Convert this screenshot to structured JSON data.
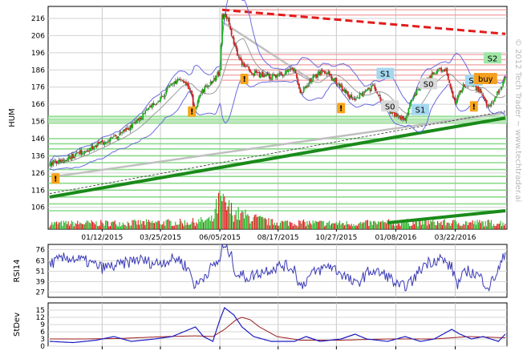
{
  "chart_data": {
    "type": "candlestick",
    "symbol": "HUM",
    "watermark": "© 2012 Tech Trader ~ www.techtrader.ai",
    "main": {
      "ylabel": "HUM",
      "y_ticks": [
        216,
        206,
        196,
        186,
        176,
        166,
        156,
        146,
        136,
        126,
        116,
        106
      ],
      "ylim": [
        97,
        223
      ],
      "x_tick_labels": [
        "01/12/2015",
        "03/25/2015",
        "06/05/2015",
        "08/17/2015",
        "10/27/2015",
        "01/08/2016",
        "03/22/2016"
      ],
      "x_tick_index": [
        45,
        95,
        146,
        196,
        246,
        297,
        348
      ],
      "n_bars": 392,
      "price_path": [
        [
          0,
          131
        ],
        [
          20,
          136
        ],
        [
          40,
          142
        ],
        [
          60,
          148
        ],
        [
          80,
          160
        ],
        [
          95,
          170
        ],
        [
          110,
          181
        ],
        [
          120,
          176
        ],
        [
          124,
          163
        ],
        [
          130,
          173
        ],
        [
          140,
          180
        ],
        [
          146,
          185
        ],
        [
          148,
          218
        ],
        [
          153,
          216
        ],
        [
          158,
          200
        ],
        [
          165,
          190
        ],
        [
          175,
          184
        ],
        [
          190,
          182
        ],
        [
          200,
          184
        ],
        [
          210,
          186
        ],
        [
          215,
          172
        ],
        [
          225,
          181
        ],
        [
          235,
          186
        ],
        [
          245,
          180
        ],
        [
          255,
          172
        ],
        [
          262,
          168
        ],
        [
          270,
          174
        ],
        [
          278,
          176
        ],
        [
          285,
          167
        ],
        [
          295,
          160
        ],
        [
          305,
          158
        ],
        [
          312,
          171
        ],
        [
          322,
          178
        ],
        [
          332,
          186
        ],
        [
          340,
          185
        ],
        [
          348,
          167
        ],
        [
          355,
          177
        ],
        [
          362,
          178
        ],
        [
          370,
          173
        ],
        [
          377,
          164
        ],
        [
          385,
          173
        ],
        [
          391,
          182
        ]
      ],
      "resistance_lines": [
        180,
        183,
        186,
        189,
        192,
        195,
        218,
        221
      ],
      "support_lines": [
        104,
        108,
        112,
        116,
        120,
        124,
        128,
        132,
        136,
        140,
        143,
        146,
        155,
        157,
        159
      ],
      "trendlines": [
        {
          "style": "dashed-red",
          "from": [
            148,
            221
          ],
          "to": [
            391,
            207
          ]
        },
        {
          "style": "solid-green",
          "from": [
            0,
            112
          ],
          "to": [
            391,
            158
          ]
        },
        {
          "style": "solid-green",
          "from": [
            290,
            97
          ],
          "to": [
            391,
            104
          ]
        },
        {
          "style": "solid-gray",
          "from": [
            5,
            124
          ],
          "to": [
            391,
            161
          ]
        },
        {
          "style": "solid-gray",
          "from": [
            148,
            214
          ],
          "to": [
            225,
            180
          ]
        },
        {
          "style": "dotted-black",
          "from": [
            0,
            114
          ],
          "to": [
            391,
            162
          ]
        }
      ],
      "signal_markers": [
        {
          "label": "!",
          "index": 5,
          "price": 123
        },
        {
          "label": "!",
          "index": 122,
          "price": 162
        },
        {
          "label": "!",
          "index": 167,
          "price": 181
        },
        {
          "label": "!",
          "index": 250,
          "price": 164
        },
        {
          "label": "!",
          "index": 364,
          "price": 165
        }
      ],
      "level_tags": [
        {
          "label": "S1",
          "index": 288,
          "price": 184,
          "color": "#a5d8ef"
        },
        {
          "label": "S0",
          "index": 325,
          "price": 178,
          "color": "#d9d9d9"
        },
        {
          "label": "S0",
          "index": 292,
          "price": 165,
          "color": "#d9d9d9"
        },
        {
          "label": "S1",
          "index": 318,
          "price": 163,
          "color": "#a5d8ef"
        },
        {
          "label": "S1",
          "index": 364,
          "price": 180,
          "color": "#a5d8ef"
        },
        {
          "label": "S2",
          "index": 380,
          "price": 193,
          "color": "#9fe6a6"
        },
        {
          "label": "buy",
          "index": 374,
          "price": 181,
          "color": "#f5a020"
        }
      ],
      "volume_pattern": [
        [
          0,
          0.18
        ],
        [
          60,
          0.2
        ],
        [
          120,
          0.22
        ],
        [
          140,
          0.3
        ],
        [
          146,
          1.0
        ],
        [
          150,
          0.75
        ],
        [
          160,
          0.5
        ],
        [
          175,
          0.35
        ],
        [
          190,
          0.22
        ],
        [
          260,
          0.18
        ],
        [
          300,
          0.22
        ],
        [
          391,
          0.2
        ]
      ]
    },
    "rsi": {
      "label": "RSI14",
      "y_ticks": [
        76,
        63,
        51,
        39,
        27
      ],
      "ylim": [
        21,
        82
      ],
      "path": [
        [
          0,
          60
        ],
        [
          15,
          67
        ],
        [
          30,
          63
        ],
        [
          45,
          55
        ],
        [
          60,
          58
        ],
        [
          75,
          65
        ],
        [
          90,
          60
        ],
        [
          110,
          66
        ],
        [
          120,
          52
        ],
        [
          125,
          33
        ],
        [
          135,
          50
        ],
        [
          146,
          64
        ],
        [
          148,
          80
        ],
        [
          155,
          72
        ],
        [
          160,
          48
        ],
        [
          170,
          44
        ],
        [
          185,
          52
        ],
        [
          200,
          58
        ],
        [
          210,
          54
        ],
        [
          215,
          33
        ],
        [
          225,
          48
        ],
        [
          240,
          58
        ],
        [
          255,
          44
        ],
        [
          262,
          35
        ],
        [
          275,
          52
        ],
        [
          290,
          46
        ],
        [
          300,
          32
        ],
        [
          310,
          38
        ],
        [
          322,
          60
        ],
        [
          335,
          66
        ],
        [
          345,
          55
        ],
        [
          350,
          36
        ],
        [
          358,
          52
        ],
        [
          368,
          46
        ],
        [
          377,
          33
        ],
        [
          386,
          55
        ],
        [
          391,
          72
        ]
      ]
    },
    "stdev": {
      "label": "StDev",
      "y_ticks": [
        15,
        12,
        9,
        6,
        3,
        0
      ],
      "ylim": [
        0,
        18
      ],
      "sd_path": [
        [
          0,
          2
        ],
        [
          20,
          1.5
        ],
        [
          40,
          2.5
        ],
        [
          55,
          4
        ],
        [
          70,
          2
        ],
        [
          90,
          3
        ],
        [
          105,
          4
        ],
        [
          115,
          6
        ],
        [
          125,
          8
        ],
        [
          132,
          4
        ],
        [
          140,
          2
        ],
        [
          146,
          11
        ],
        [
          150,
          16
        ],
        [
          158,
          13
        ],
        [
          165,
          8
        ],
        [
          175,
          4
        ],
        [
          190,
          2
        ],
        [
          210,
          2
        ],
        [
          220,
          4
        ],
        [
          232,
          2
        ],
        [
          250,
          3
        ],
        [
          262,
          5
        ],
        [
          272,
          3
        ],
        [
          290,
          2
        ],
        [
          305,
          4
        ],
        [
          318,
          2
        ],
        [
          330,
          3
        ],
        [
          345,
          7
        ],
        [
          352,
          5
        ],
        [
          362,
          3
        ],
        [
          372,
          4
        ],
        [
          385,
          2
        ],
        [
          391,
          5
        ]
      ],
      "ma_path": [
        [
          0,
          3
        ],
        [
          30,
          3
        ],
        [
          60,
          3.2
        ],
        [
          100,
          4
        ],
        [
          125,
          4.3
        ],
        [
          140,
          4
        ],
        [
          150,
          7
        ],
        [
          160,
          11
        ],
        [
          165,
          12
        ],
        [
          172,
          11
        ],
        [
          180,
          8
        ],
        [
          195,
          4
        ],
        [
          215,
          2.5
        ],
        [
          250,
          2.5
        ],
        [
          290,
          3
        ],
        [
          330,
          3
        ],
        [
          360,
          4
        ],
        [
          391,
          3.5
        ]
      ]
    }
  }
}
